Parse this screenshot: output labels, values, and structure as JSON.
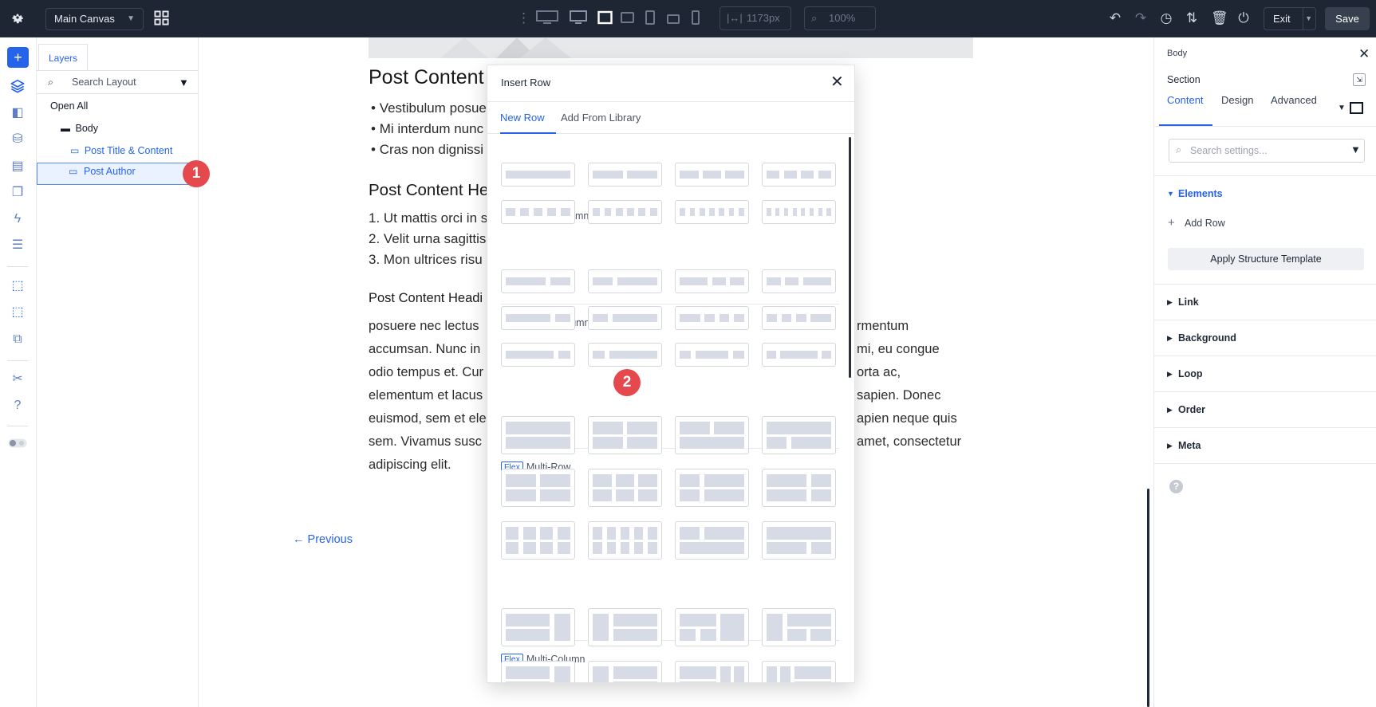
{
  "topbar": {
    "canvas_select": "Main Canvas",
    "width_value": "1173px",
    "zoom_value": "100%",
    "exit_label": "Exit",
    "save_label": "Save"
  },
  "layers": {
    "tab_label": "Layers",
    "search_placeholder": "Search Layout",
    "open_all": "Open All",
    "items": [
      {
        "label": "Body"
      },
      {
        "label": "Post Title & Content"
      },
      {
        "label": "Post Author"
      }
    ]
  },
  "badges": {
    "one": "1",
    "two": "2"
  },
  "canvas": {
    "heading1": "Post Content",
    "bullets": [
      "Vestibulum posue",
      "Mi interdum nunc",
      "Cras non dignissi"
    ],
    "heading2": "Post Content He",
    "numbered": [
      "1. Ut mattis orci in s",
      "2. Velit urna sagittis",
      "3. Mon ultrices risu"
    ],
    "heading3": "Post Content Headi",
    "para_left": [
      "posuere nec lectus",
      "accumsan. Nunc in",
      "odio tempus et. Cur",
      "elementum et lacus",
      "euismod, sem et ele",
      "sem. Vivamus susc",
      "adipiscing elit."
    ],
    "para_right": [
      "rmentum",
      "mi, eu congue",
      "orta ac,",
      "sapien. Donec",
      "apien neque quis",
      "amet, consectetur"
    ],
    "previous_link": "← Previous"
  },
  "modal": {
    "title": "Insert Row",
    "tabs": [
      "New Row",
      "Add From Library"
    ],
    "flex_tag": "Flex",
    "sections": [
      "Equal Columns",
      "Offset Columns",
      "Multi-Row",
      "Multi-Column"
    ]
  },
  "right_panel": {
    "breadcrumb": "Body",
    "element_type": "Section",
    "tabs": [
      "Content",
      "Design",
      "Advanced"
    ],
    "search_placeholder": "Search settings...",
    "elements_title": "Elements",
    "add_row": "Add Row",
    "structure_button": "Apply Structure Template",
    "accordions": [
      "Link",
      "Background",
      "Loop",
      "Order",
      "Meta"
    ]
  },
  "colors": {
    "accent": "#2563eb",
    "topbar": "#1e2533",
    "badge": "#e5484d"
  }
}
